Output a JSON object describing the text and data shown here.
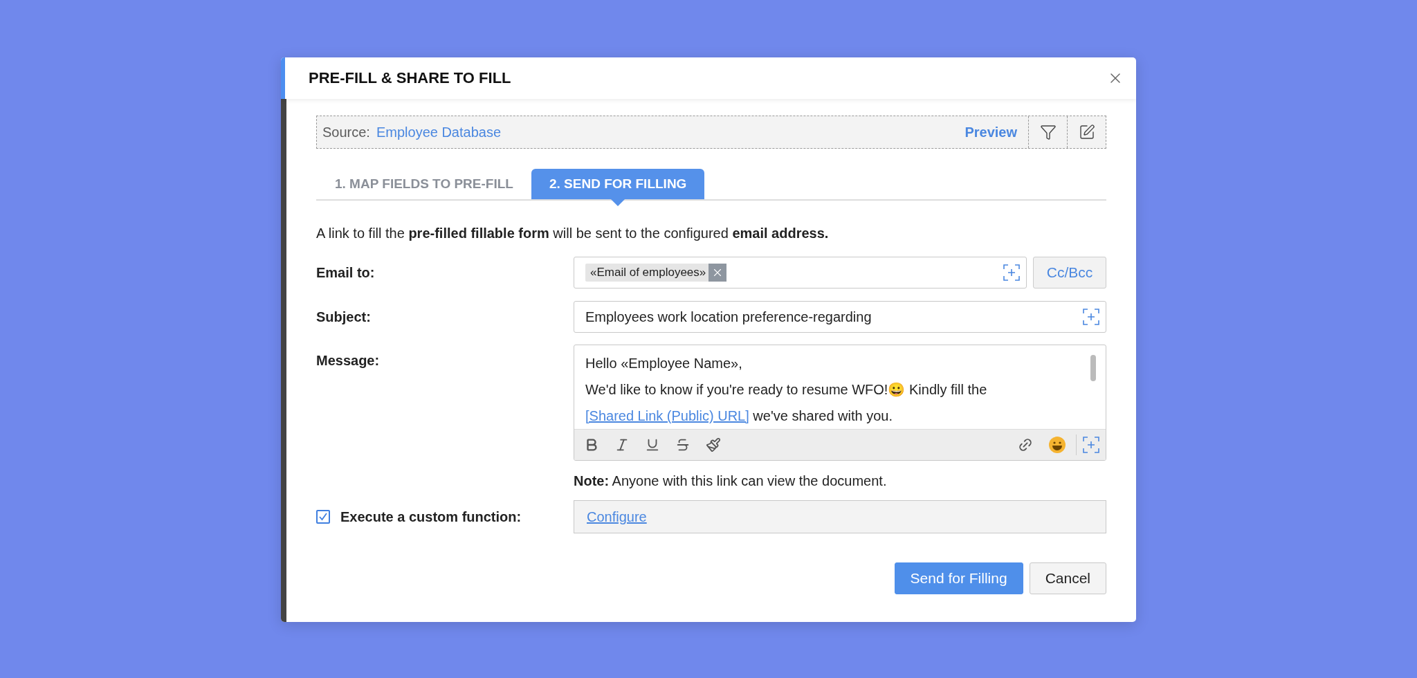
{
  "dialog": {
    "title": "PRE-FILL & SHARE TO FILL"
  },
  "source": {
    "label": "Source:",
    "value": "Employee Database",
    "preview": "Preview"
  },
  "tabs": [
    {
      "label": "1. MAP FIELDS TO PRE-FILL",
      "selected": false
    },
    {
      "label": "2. SEND FOR FILLING",
      "selected": true
    }
  ],
  "description": "A link to fill the **pre-filled fillable form** will be sent to the configured **email address.**",
  "email_to": {
    "label": "Email to:",
    "tags": [
      "«Email of employees»"
    ],
    "cc_bcc": "Cc/Bcc"
  },
  "subject": {
    "label": "Subject:",
    "value": "Employees work location preference-regarding"
  },
  "message": {
    "label": "Message:",
    "greeting": "Hello «Employee Name»,",
    "body_before": "We'd like to know if you're ready to resume WFO!😀 Kindly fill the",
    "link": "[Shared Link (Public) URL]",
    "body_after": "we've shared with you."
  },
  "note": "**Note:** Anyone with this link can view the document.",
  "custom_function": {
    "label": "Execute a custom function:",
    "checked": true,
    "link": "Configure"
  },
  "buttons": [
    {
      "kind": "primary",
      "label": "Send for Filling"
    },
    {
      "kind": "secondary",
      "label": "Cancel"
    }
  ]
}
